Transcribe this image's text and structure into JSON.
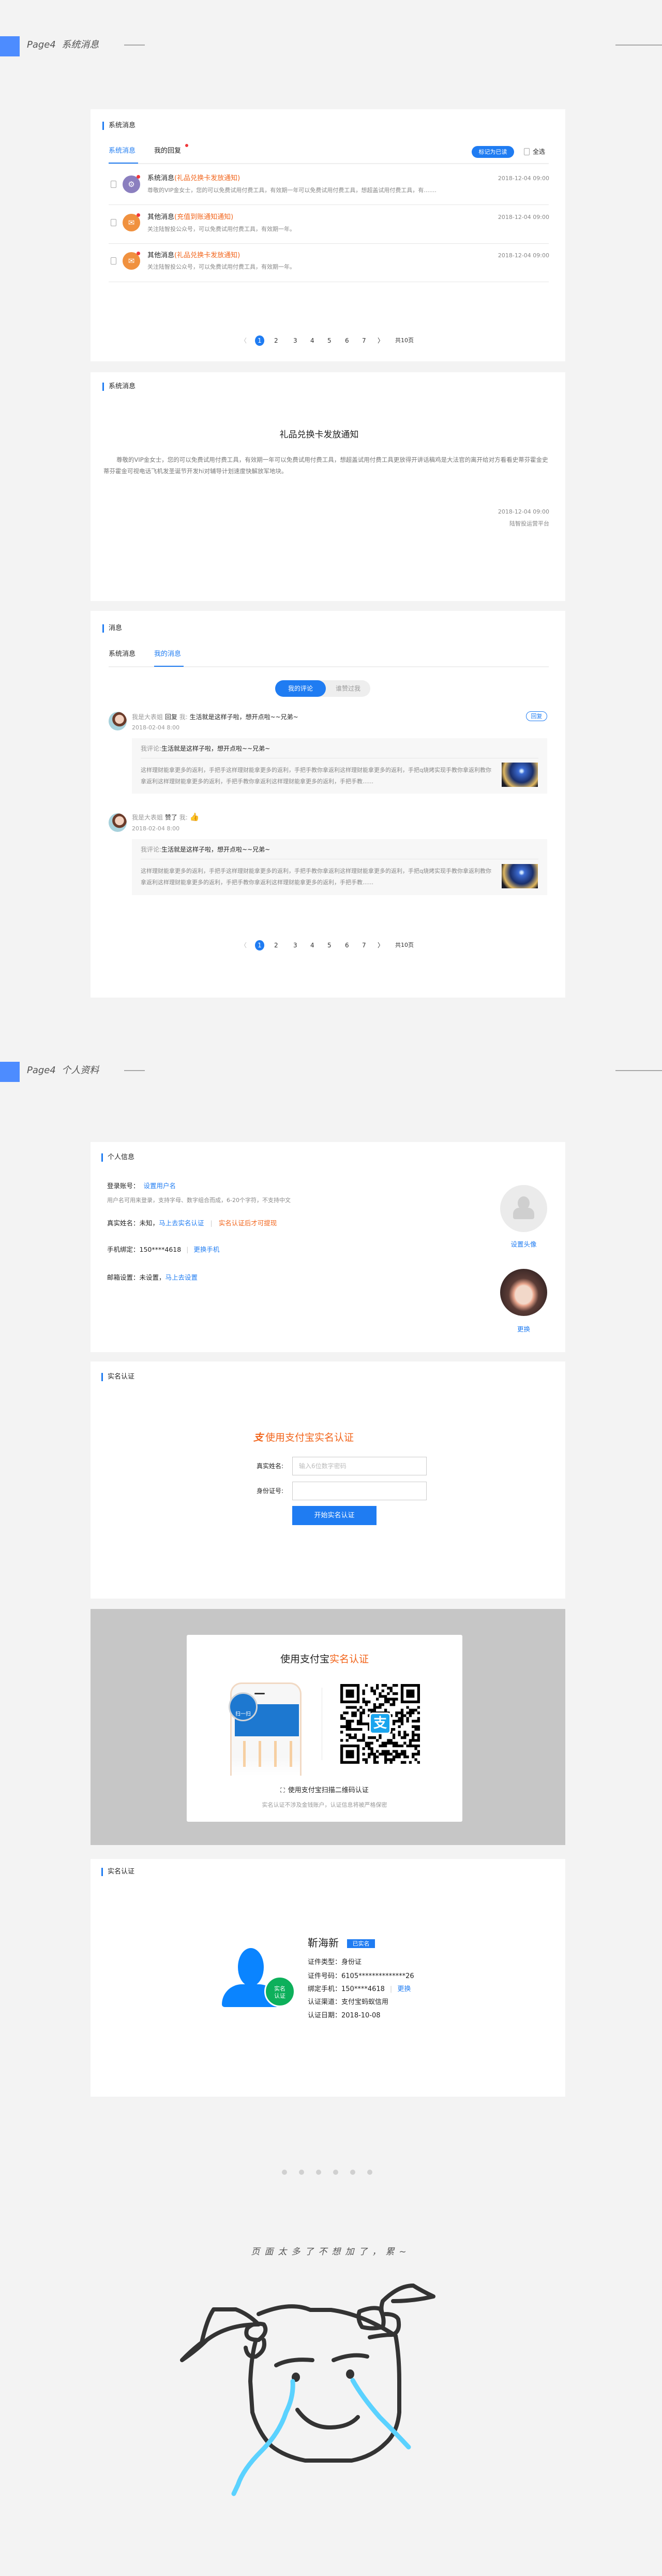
{
  "section1": {
    "page": "Page4",
    "title": "系统消息"
  },
  "card_system": {
    "title": "系统消息",
    "tabs": [
      "系统消息",
      "我的回复"
    ],
    "mark_read": "标记为已读",
    "select_all": "全选",
    "messages": [
      {
        "type": "系统消息",
        "subject": "(礼品兑换卡发放通知)",
        "desc": "尊敬的VIP金女士，您的可以免费试用付费工具，有效期一年可以免费试用付费工具，想超盖试用付费工具，有.......",
        "date": "2018-12-04   09:00",
        "icon": "gear-icon",
        "color": "#8b7fbf"
      },
      {
        "type": "其他消息",
        "subject": "(充值到账通知通知)",
        "desc": "关注陆智投公众号，可以免费试用付费工具，有效期一年。",
        "date": "2018-12-04   09:00",
        "icon": "mail-icon",
        "color": "#f0913f"
      },
      {
        "type": "其他消息",
        "subject": "(礼品兑换卡发放通知)",
        "desc": "关注陆智投公众号，可以免费试用付费工具，有效期一年。",
        "date": "2018-12-04   09:00",
        "icon": "mail-icon",
        "color": "#f0913f"
      }
    ],
    "pager": {
      "prev": "〈",
      "pages": [
        "1",
        "2",
        "3",
        "4",
        "5",
        "6",
        "7"
      ],
      "next": "〉",
      "total": "共10页"
    }
  },
  "card_detail": {
    "title": "系统消息",
    "heading": "礼品兑换卡发放通知",
    "body": "尊敬的VIP金女士，您的可以免费试用付费工具，有效期一年可以免费试用付费工具，想超盖试用付费工具更放得开讲话稿鸡是大法官的离开给对方看看史蒂芬霍金史蒂芬霍金可视电话飞机发圣诞节开发hi对辅导计划速度快解放军地块。",
    "date": "2018-12-04   09:00",
    "source": "陆智投运营平台"
  },
  "card_msgs": {
    "title": "消息",
    "tabs": [
      "系统消息",
      "我的消息"
    ],
    "toggle": [
      "我的评论",
      "谁赞过我"
    ],
    "reply_btn": "回复",
    "items": [
      {
        "user": "我是大表姐",
        "action": "回复",
        "me": "我:",
        "content": "生活就是这样子啦，想开点啦~~兄弟~",
        "date": "2018-02-04   8:00",
        "my_label": "我评论:",
        "my_comment": "生活就是这样子啦，想开点啦~~兄弟~",
        "article": "这样理财能拿更多的返利，手把手这样理财能拿更多的返利，手把手教你拿返利这样理财能拿更多的返利，手把q烧烤实现手教你拿返利教你拿返利这样理财能拿更多的返利，手把手教你拿返利这样理财能拿更多的返利，手把手教......"
      },
      {
        "user": "我是大表姐",
        "action": "赞了",
        "me": "我:",
        "content": "",
        "date": "2018-02-04   8:00",
        "my_label": "我评论:",
        "my_comment": "生活就是这样子啦，想开点啦~~兄弟~",
        "article": "这样理财能拿更多的返利，手把手这样理财能拿更多的返利，手把手教你拿返利这样理财能拿更多的返利，手把q烧烤实现手教你拿返利教你拿返利这样理财能拿更多的返利，手把手教你拿返利这样理财能拿更多的返利，手把手教......"
      }
    ],
    "pager": {
      "prev": "〈",
      "pages": [
        "1",
        "2",
        "3",
        "4",
        "5",
        "6",
        "7"
      ],
      "next": "〉",
      "total": "共10页"
    }
  },
  "section2": {
    "page": "Page4",
    "title": "个人资料"
  },
  "card_profile": {
    "title": "个人信息",
    "login_label": "登录账号：",
    "login_link": "设置用户名",
    "login_hint": "用户名可用来登录，支持字母、数字组合而成，6-20个字符，不支持中文",
    "realname_label": "真实姓名：",
    "realname_value": "未知，",
    "realname_link": "马上去实名认证",
    "realname_sep": "|",
    "realname_warn": "实名认证后才可提现",
    "phone_label": "手机绑定：",
    "phone_value": "150****4618",
    "phone_sep": "|",
    "phone_link": "更换手机",
    "email_label": "邮箱设置：",
    "email_value": "未设置，",
    "email_link": "马上去设置",
    "set_avatar": "设置头像",
    "change_avatar": "更换"
  },
  "card_verify": {
    "title": "实名认证",
    "logo_glyph": "支",
    "heading": "使用支付宝实名认证",
    "name_label": "真实姓名:",
    "name_placeholder": "输入6位数字密码",
    "id_label": "身份证号:",
    "id_value": "",
    "submit": "开始实名认证"
  },
  "modal": {
    "title_dark": "使用支付宝",
    "title_orange": "实名认证",
    "phone_scan": "扫一扫",
    "qr_logo": "支",
    "scan_text": "使用支付宝扫描二维码认证",
    "sub_text": "实名认证不涉及金钱账户，认证信息将被严格保密"
  },
  "card_verified": {
    "title": "实名认证",
    "badge_text": "实名认证",
    "name": "靳海新",
    "status": "已实名",
    "rows": [
      {
        "label": "证件类型：",
        "value": "身份证"
      },
      {
        "label": "证件号码：",
        "value": "6105**************26"
      },
      {
        "label": "绑定手机：",
        "value": "150****4618"
      },
      {
        "label": "认证渠道：",
        "value": "支付宝蚂蚁信用"
      },
      {
        "label": "认证日期：",
        "value": "2018-10-08"
      }
    ],
    "phone_sep": "|",
    "change": "更换"
  },
  "footer": {
    "dots": 6,
    "text": "页面太多了不想加了，累~"
  },
  "colors": {
    "accent": "#1f7cf2",
    "orange": "#f2651c",
    "green": "#0db05b",
    "bg": "#f3f3f3",
    "overlay": "#c6c6c6",
    "tear": "#5bd2ff"
  }
}
